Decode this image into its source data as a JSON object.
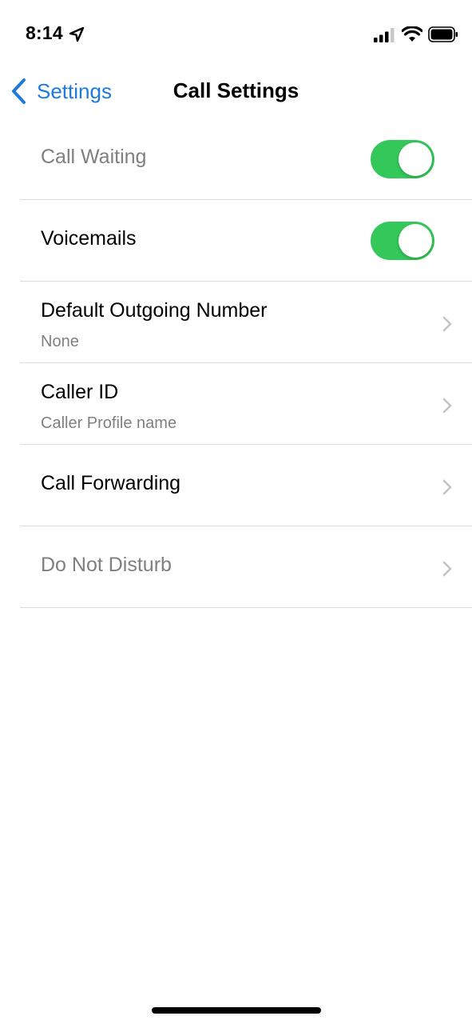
{
  "status_bar": {
    "time": "8:14",
    "icons": [
      "location-arrow-icon",
      "cellular-signal-icon",
      "wifi-icon",
      "battery-icon"
    ]
  },
  "nav": {
    "back_label": "Settings",
    "title": "Call Settings"
  },
  "rows": [
    {
      "title": "Call Waiting",
      "control": "toggle",
      "on": true,
      "disabled": true
    },
    {
      "title": "Voicemails",
      "control": "toggle",
      "on": true,
      "disabled": false
    },
    {
      "title": "Default Outgoing Number",
      "subtitle": "None",
      "control": "chevron",
      "disabled": false
    },
    {
      "title": "Caller ID",
      "subtitle": "Caller Profile name",
      "control": "chevron",
      "disabled": false
    },
    {
      "title": "Call Forwarding",
      "control": "chevron",
      "disabled": false
    },
    {
      "title": "Do Not Disturb",
      "control": "chevron",
      "disabled": true
    }
  ],
  "colors": {
    "accent": "#1f7ae0",
    "toggle_on": "#34c759",
    "disabled_text": "#7f7f7f",
    "chevron": "#c4c4c6"
  }
}
